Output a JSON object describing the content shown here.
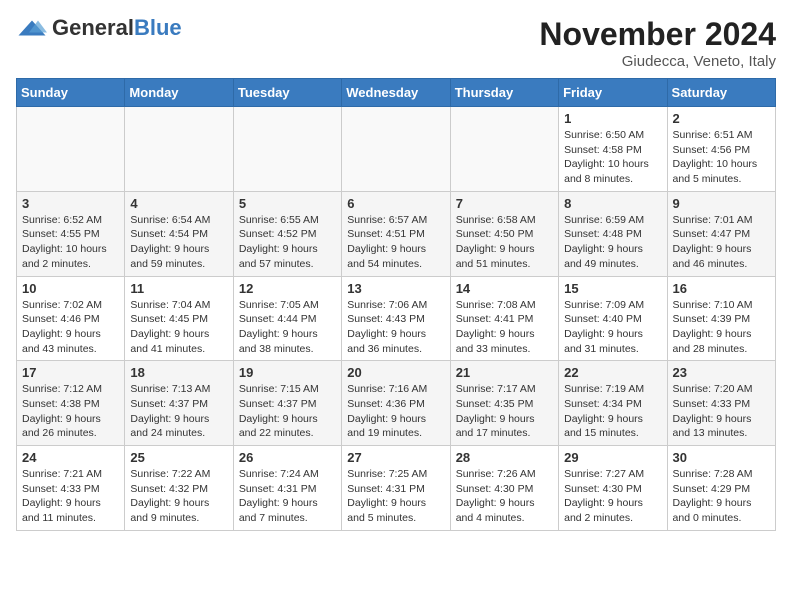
{
  "header": {
    "logo_general": "General",
    "logo_blue": "Blue",
    "month_title": "November 2024",
    "location": "Giudecca, Veneto, Italy"
  },
  "days_of_week": [
    "Sunday",
    "Monday",
    "Tuesday",
    "Wednesday",
    "Thursday",
    "Friday",
    "Saturday"
  ],
  "weeks": [
    [
      {
        "day": "",
        "info": ""
      },
      {
        "day": "",
        "info": ""
      },
      {
        "day": "",
        "info": ""
      },
      {
        "day": "",
        "info": ""
      },
      {
        "day": "",
        "info": ""
      },
      {
        "day": "1",
        "info": "Sunrise: 6:50 AM\nSunset: 4:58 PM\nDaylight: 10 hours and 8 minutes."
      },
      {
        "day": "2",
        "info": "Sunrise: 6:51 AM\nSunset: 4:56 PM\nDaylight: 10 hours and 5 minutes."
      }
    ],
    [
      {
        "day": "3",
        "info": "Sunrise: 6:52 AM\nSunset: 4:55 PM\nDaylight: 10 hours and 2 minutes."
      },
      {
        "day": "4",
        "info": "Sunrise: 6:54 AM\nSunset: 4:54 PM\nDaylight: 9 hours and 59 minutes."
      },
      {
        "day": "5",
        "info": "Sunrise: 6:55 AM\nSunset: 4:52 PM\nDaylight: 9 hours and 57 minutes."
      },
      {
        "day": "6",
        "info": "Sunrise: 6:57 AM\nSunset: 4:51 PM\nDaylight: 9 hours and 54 minutes."
      },
      {
        "day": "7",
        "info": "Sunrise: 6:58 AM\nSunset: 4:50 PM\nDaylight: 9 hours and 51 minutes."
      },
      {
        "day": "8",
        "info": "Sunrise: 6:59 AM\nSunset: 4:48 PM\nDaylight: 9 hours and 49 minutes."
      },
      {
        "day": "9",
        "info": "Sunrise: 7:01 AM\nSunset: 4:47 PM\nDaylight: 9 hours and 46 minutes."
      }
    ],
    [
      {
        "day": "10",
        "info": "Sunrise: 7:02 AM\nSunset: 4:46 PM\nDaylight: 9 hours and 43 minutes."
      },
      {
        "day": "11",
        "info": "Sunrise: 7:04 AM\nSunset: 4:45 PM\nDaylight: 9 hours and 41 minutes."
      },
      {
        "day": "12",
        "info": "Sunrise: 7:05 AM\nSunset: 4:44 PM\nDaylight: 9 hours and 38 minutes."
      },
      {
        "day": "13",
        "info": "Sunrise: 7:06 AM\nSunset: 4:43 PM\nDaylight: 9 hours and 36 minutes."
      },
      {
        "day": "14",
        "info": "Sunrise: 7:08 AM\nSunset: 4:41 PM\nDaylight: 9 hours and 33 minutes."
      },
      {
        "day": "15",
        "info": "Sunrise: 7:09 AM\nSunset: 4:40 PM\nDaylight: 9 hours and 31 minutes."
      },
      {
        "day": "16",
        "info": "Sunrise: 7:10 AM\nSunset: 4:39 PM\nDaylight: 9 hours and 28 minutes."
      }
    ],
    [
      {
        "day": "17",
        "info": "Sunrise: 7:12 AM\nSunset: 4:38 PM\nDaylight: 9 hours and 26 minutes."
      },
      {
        "day": "18",
        "info": "Sunrise: 7:13 AM\nSunset: 4:37 PM\nDaylight: 9 hours and 24 minutes."
      },
      {
        "day": "19",
        "info": "Sunrise: 7:15 AM\nSunset: 4:37 PM\nDaylight: 9 hours and 22 minutes."
      },
      {
        "day": "20",
        "info": "Sunrise: 7:16 AM\nSunset: 4:36 PM\nDaylight: 9 hours and 19 minutes."
      },
      {
        "day": "21",
        "info": "Sunrise: 7:17 AM\nSunset: 4:35 PM\nDaylight: 9 hours and 17 minutes."
      },
      {
        "day": "22",
        "info": "Sunrise: 7:19 AM\nSunset: 4:34 PM\nDaylight: 9 hours and 15 minutes."
      },
      {
        "day": "23",
        "info": "Sunrise: 7:20 AM\nSunset: 4:33 PM\nDaylight: 9 hours and 13 minutes."
      }
    ],
    [
      {
        "day": "24",
        "info": "Sunrise: 7:21 AM\nSunset: 4:33 PM\nDaylight: 9 hours and 11 minutes."
      },
      {
        "day": "25",
        "info": "Sunrise: 7:22 AM\nSunset: 4:32 PM\nDaylight: 9 hours and 9 minutes."
      },
      {
        "day": "26",
        "info": "Sunrise: 7:24 AM\nSunset: 4:31 PM\nDaylight: 9 hours and 7 minutes."
      },
      {
        "day": "27",
        "info": "Sunrise: 7:25 AM\nSunset: 4:31 PM\nDaylight: 9 hours and 5 minutes."
      },
      {
        "day": "28",
        "info": "Sunrise: 7:26 AM\nSunset: 4:30 PM\nDaylight: 9 hours and 4 minutes."
      },
      {
        "day": "29",
        "info": "Sunrise: 7:27 AM\nSunset: 4:30 PM\nDaylight: 9 hours and 2 minutes."
      },
      {
        "day": "30",
        "info": "Sunrise: 7:28 AM\nSunset: 4:29 PM\nDaylight: 9 hours and 0 minutes."
      }
    ]
  ]
}
